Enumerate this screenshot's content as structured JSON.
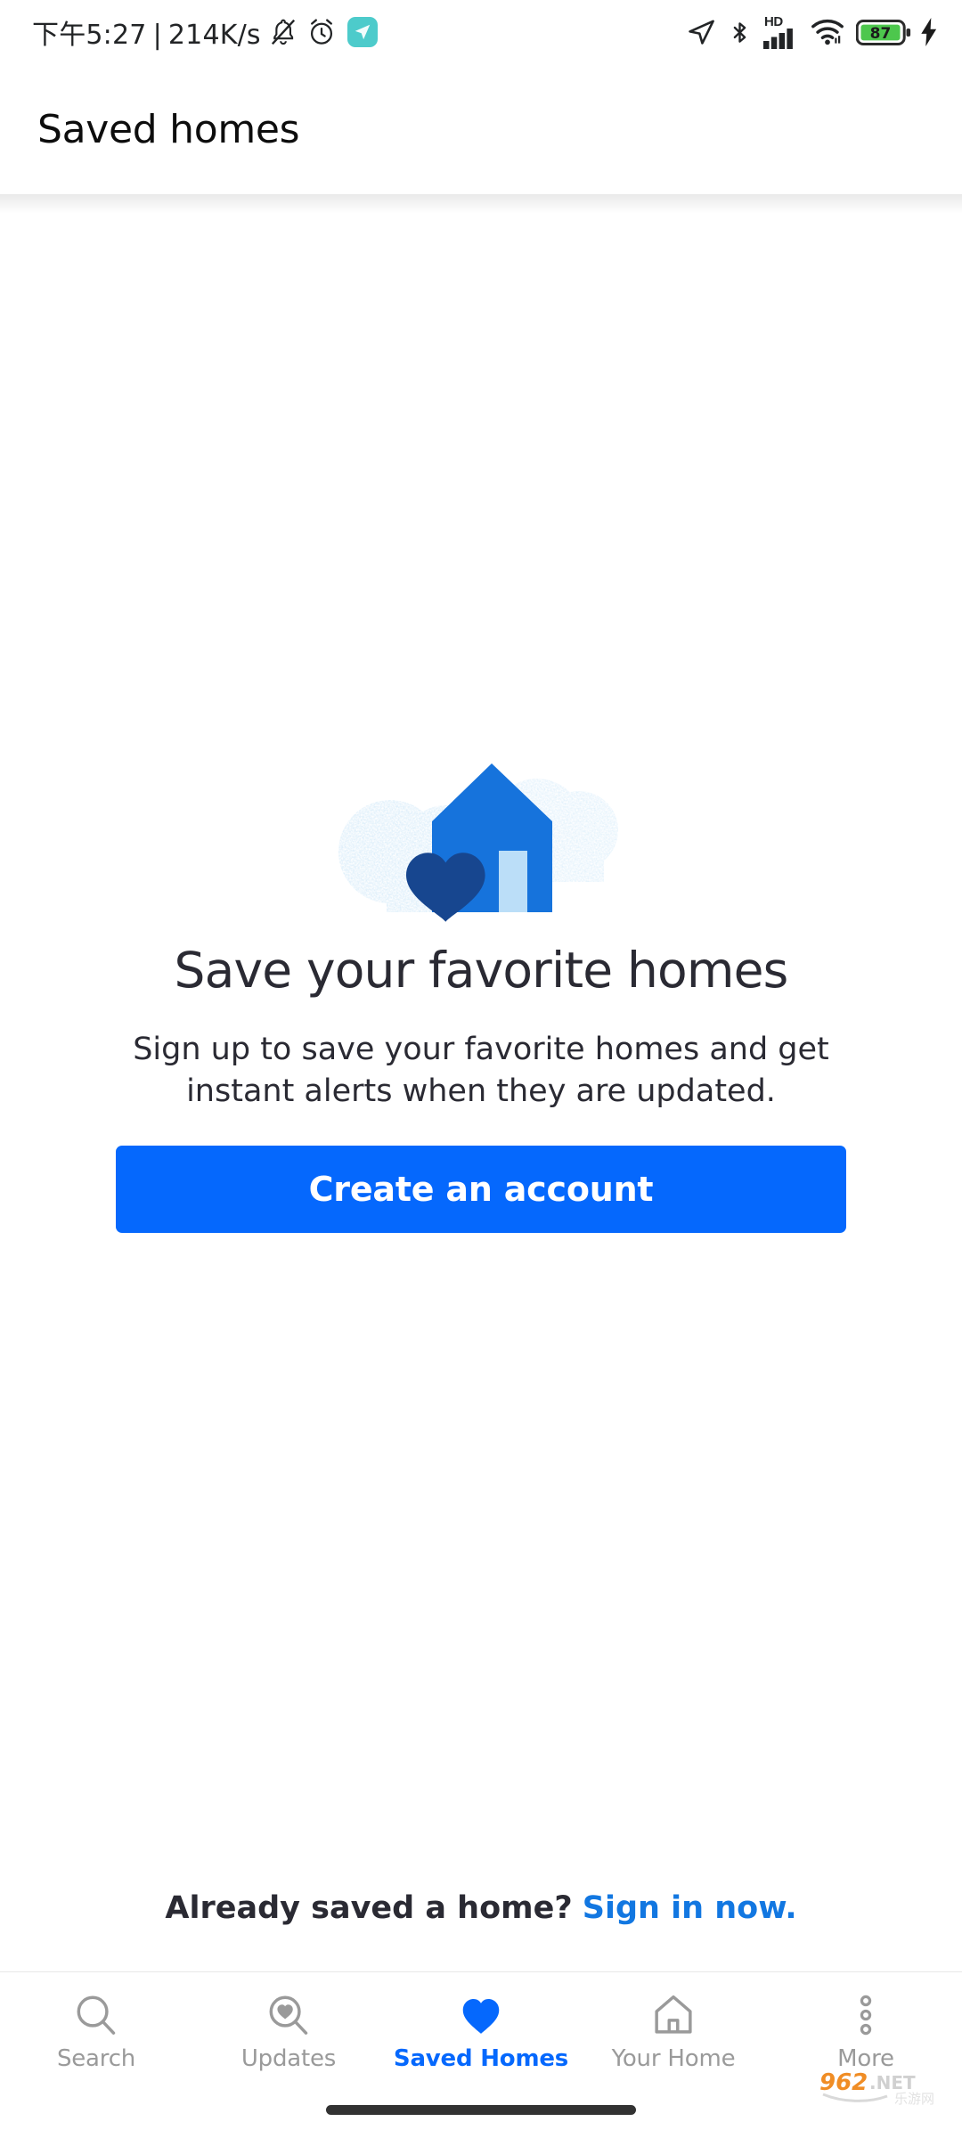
{
  "status_bar": {
    "clock": "下午5:27",
    "separator": "|",
    "network_speed": "214K/s",
    "icons_left": [
      "bell-muted-icon",
      "alarm-clock-icon",
      "navigation-chip-icon"
    ],
    "icons_right": [
      "location-arrow-icon",
      "bluetooth-icon",
      "hd-icon",
      "cellular-signal-icon",
      "wifi-icon",
      "battery-icon",
      "charging-bolt-icon"
    ],
    "hd_label": "HD",
    "battery_level": "87",
    "chip_color": "#4DCBCB",
    "battery_color": "#4DC74D"
  },
  "header": {
    "title": "Saved homes"
  },
  "empty_state": {
    "illustration_name": "house-with-heart-illustration",
    "heading": "Save your favorite homes",
    "subtitle": "Sign up to save your favorite homes and get instant alerts when they are updated.",
    "cta_label": "Create an account",
    "cta_color": "#0568FD",
    "house_color": "#1673DC",
    "door_color": "#BBDEF8",
    "heart_color": "#17468F",
    "cloud_color": "#CFE6F7"
  },
  "signin": {
    "prompt": "Already saved a home?",
    "link_label": "Sign in now.",
    "link_color": "#1277E1"
  },
  "bottom_nav": {
    "active_index": 2,
    "active_color": "#0568FD",
    "inactive_color": "#9A9A9A",
    "items": [
      {
        "label": "Search",
        "icon": "search-icon"
      },
      {
        "label": "Updates",
        "icon": "search-heart-icon"
      },
      {
        "label": "Saved Homes",
        "icon": "heart-filled-icon"
      },
      {
        "label": "Your Home",
        "icon": "house-outline-icon"
      },
      {
        "label": "More",
        "icon": "more-dots-icon"
      }
    ]
  },
  "watermark": {
    "number": "962",
    "suffix": ".NET",
    "subtext": "乐游网"
  }
}
